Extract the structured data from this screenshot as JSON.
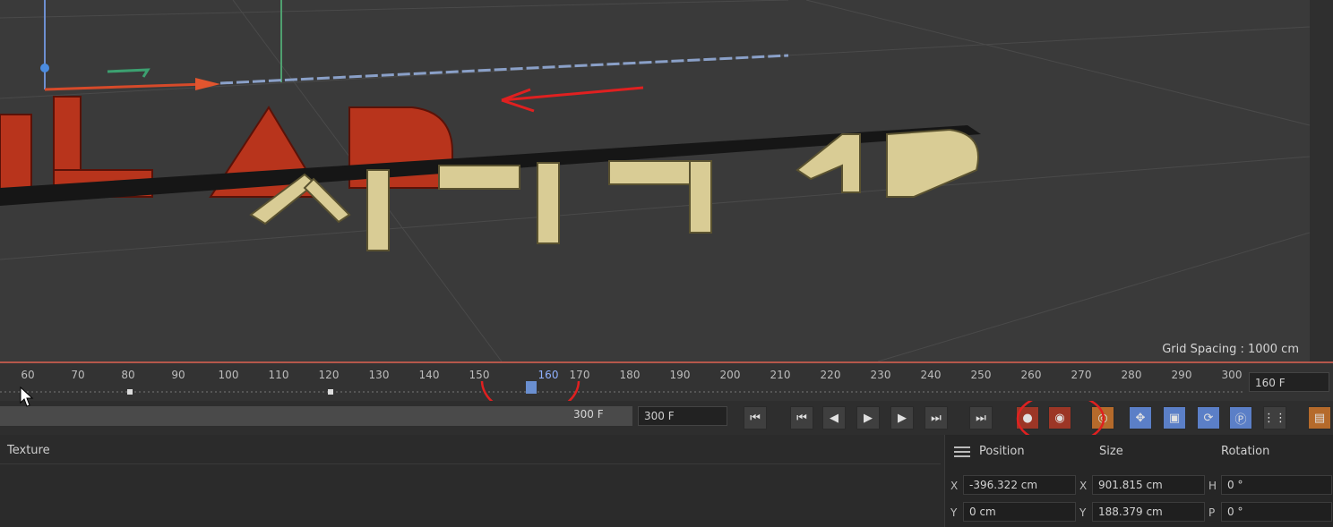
{
  "viewport": {
    "grid_spacing_label": "Grid Spacing : 1000 cm",
    "scene_text_shown": "OLAP",
    "scene_text_secondary": "시네마 4D"
  },
  "timeline": {
    "ticks": [
      "60",
      "70",
      "80",
      "90",
      "100",
      "110",
      "120",
      "130",
      "140",
      "150",
      "160",
      "170",
      "180",
      "190",
      "200",
      "210",
      "220",
      "230",
      "240",
      "250",
      "260",
      "270",
      "280",
      "290",
      "300"
    ],
    "current_frame_label": "160",
    "current_frame_field": "160 F"
  },
  "controls": {
    "range_end_label": "300 F",
    "max_frame_field": "300 F",
    "accent_color": "#5b7fc7",
    "record_color": "#9c3626"
  },
  "panels": {
    "texture_tab": "Texture",
    "coords": {
      "position_header": "Position",
      "size_header": "Size",
      "rotation_header": "Rotation",
      "pos_x_label": "X",
      "pos_x": "-396.322 cm",
      "pos_y_label": "Y",
      "pos_y": "0 cm",
      "size_x_label": "X",
      "size_x": "901.815 cm",
      "size_y_label": "Y",
      "size_y": "188.379 cm",
      "rot_h_label": "H",
      "rot_h": "0 °",
      "rot_p_label": "P",
      "rot_p": "0 °"
    }
  }
}
